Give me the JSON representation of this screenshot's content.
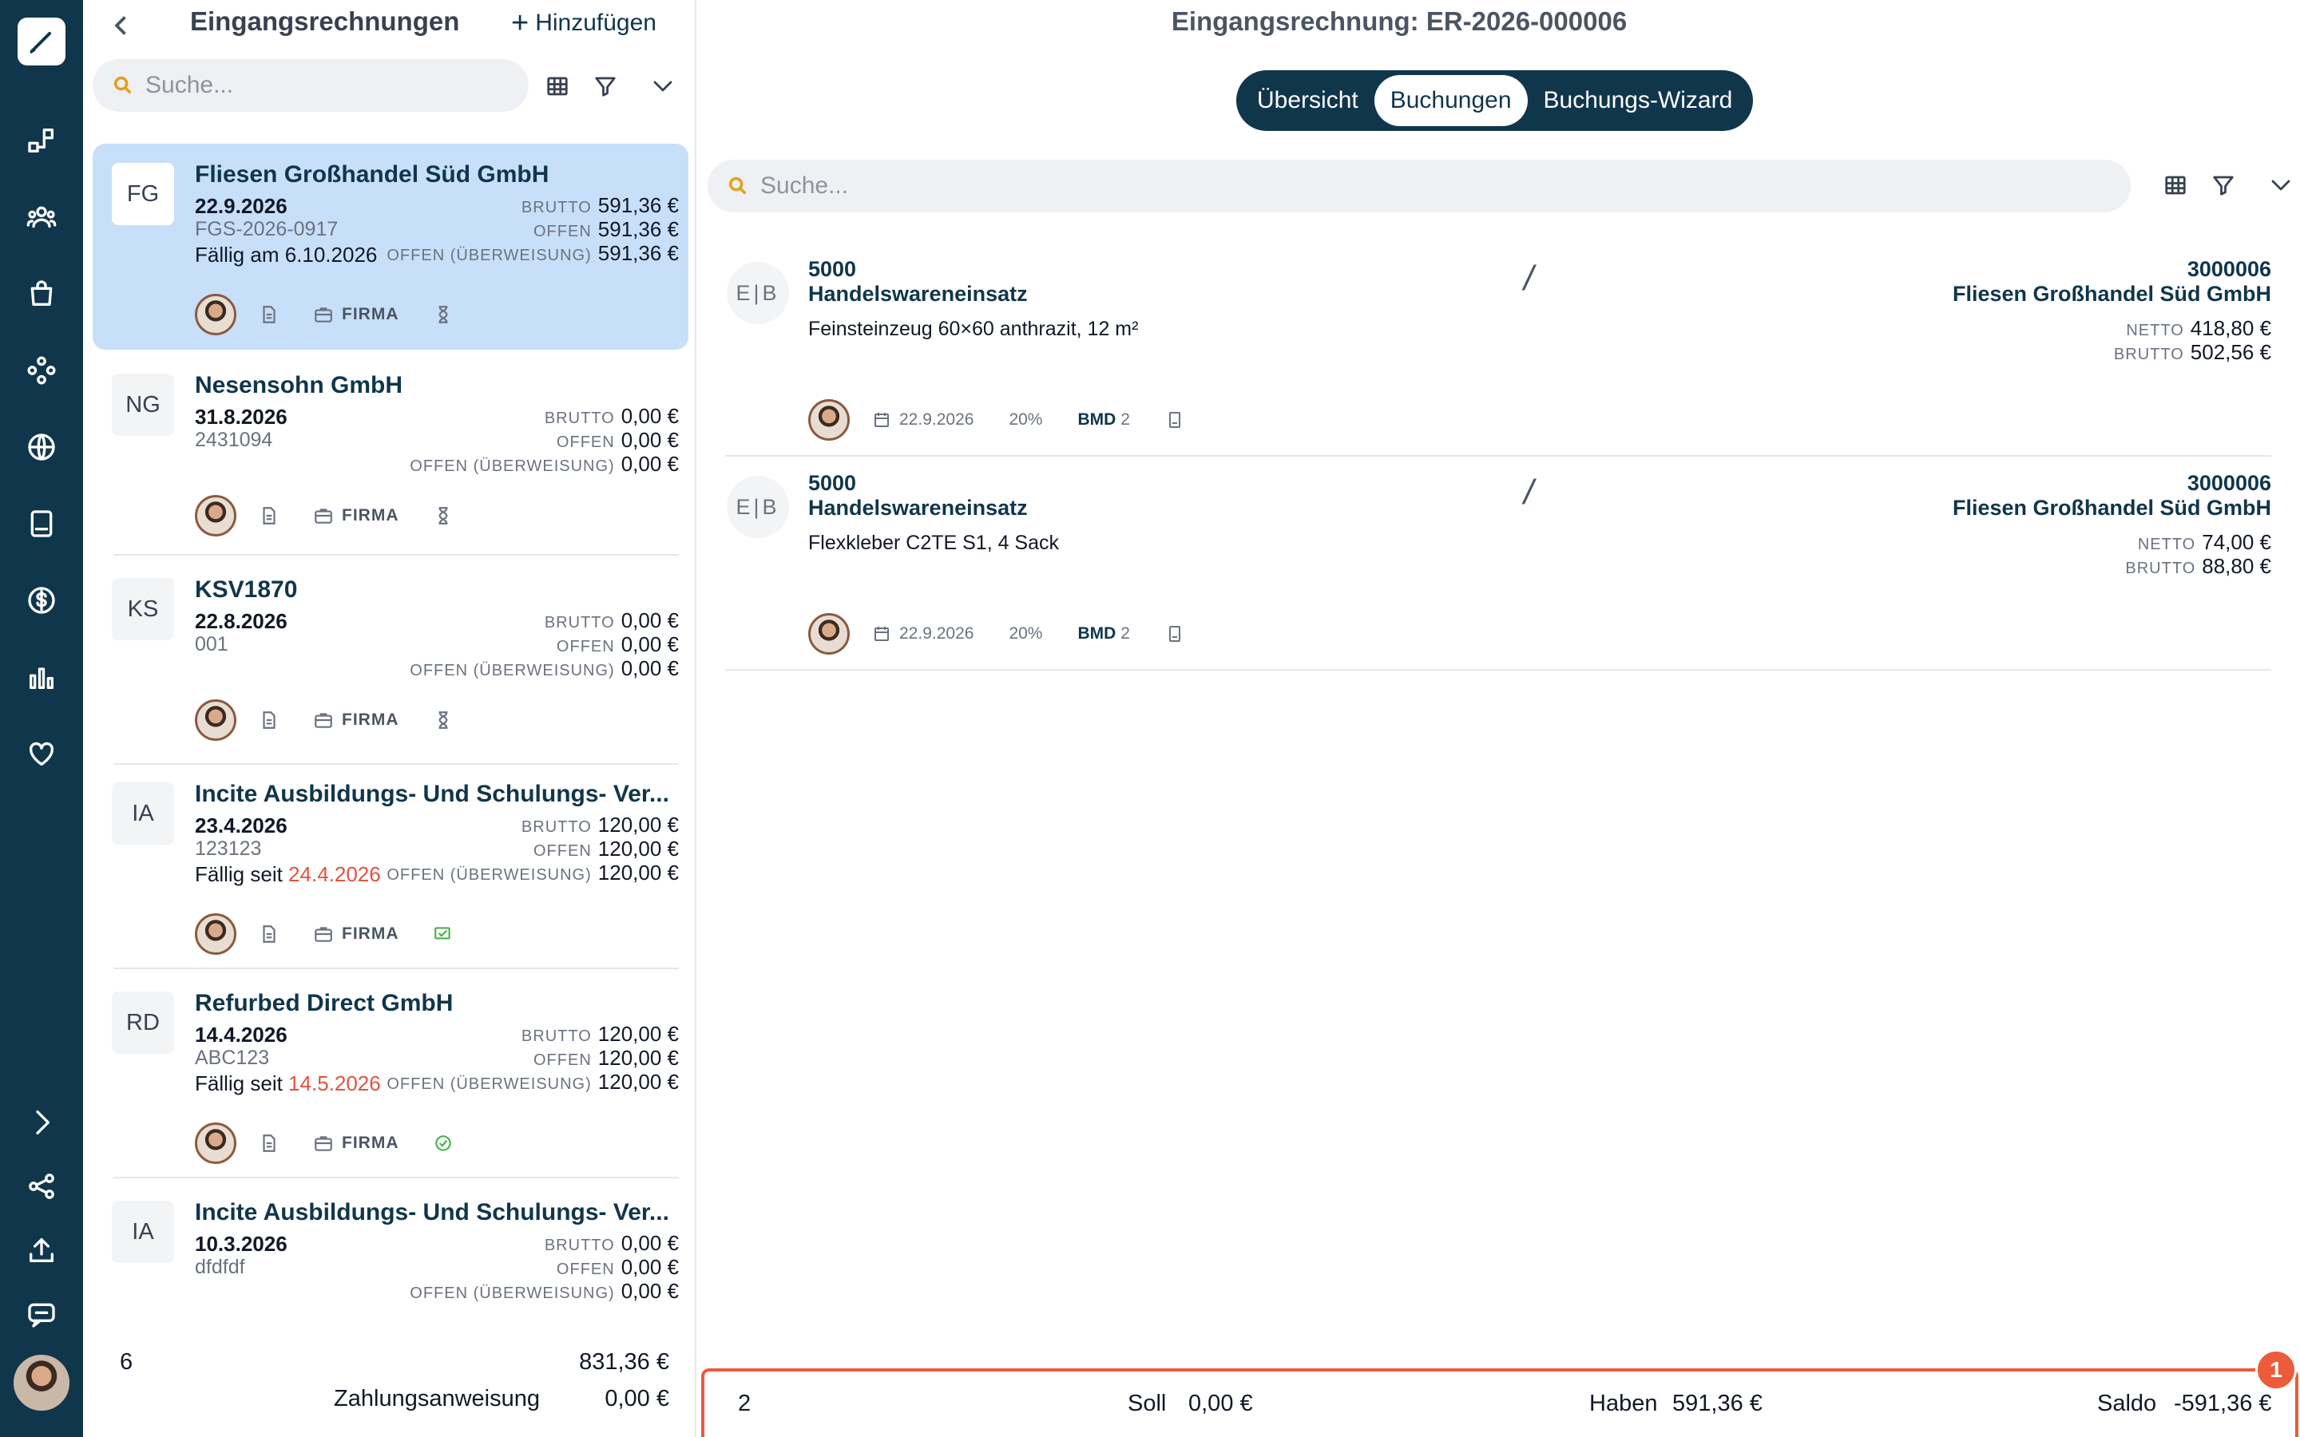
{
  "list": {
    "title": "Eingangsrechnungen",
    "add_label": "Hinzufügen",
    "search_placeholder": "Suche...",
    "items": [
      {
        "initials": "FG",
        "name": "Fliesen Großhandel Süd GmbH",
        "date": "22.9.2026",
        "ref": "FGS-2026-0917",
        "due_prefix": "Fällig am 6.10.2026",
        "due_date": "",
        "brutto": "591,36 €",
        "offen": "591,36 €",
        "offen_ueb": "591,36 €",
        "firma": "FIRMA",
        "status": "hourglass-icon"
      },
      {
        "initials": "NG",
        "name": "Nesensohn GmbH",
        "date": "31.8.2026",
        "ref": "2431094",
        "due_prefix": "",
        "due_date": "",
        "brutto": "0,00 €",
        "offen": "0,00 €",
        "offen_ueb": "0,00 €",
        "firma": "FIRMA",
        "status": "hourglass-icon"
      },
      {
        "initials": "KS",
        "name": "KSV1870",
        "date": "22.8.2026",
        "ref": "001",
        "due_prefix": "",
        "due_date": "",
        "brutto": "0,00 €",
        "offen": "0,00 €",
        "offen_ueb": "0,00 €",
        "firma": "FIRMA",
        "status": "hourglass-icon"
      },
      {
        "initials": "IA",
        "name": "Incite Ausbildungs- Und Schulungs- Ver...",
        "date": "23.4.2026",
        "ref": "123123",
        "due_prefix": "Fällig seit ",
        "due_date": "24.4.2026",
        "brutto": "120,00 €",
        "offen": "120,00 €",
        "offen_ueb": "120,00 €",
        "firma": "FIRMA",
        "status": "payment-scheduled-icon"
      },
      {
        "initials": "RD",
        "name": "Refurbed Direct GmbH",
        "date": "14.4.2026",
        "ref": "ABC123",
        "due_prefix": "Fällig seit ",
        "due_date": "14.5.2026",
        "brutto": "120,00 €",
        "offen": "120,00 €",
        "offen_ueb": "120,00 €",
        "firma": "FIRMA",
        "status": "check-circle-icon"
      },
      {
        "initials": "IA",
        "name": "Incite Ausbildungs- Und Schulungs- Ver...",
        "date": "10.3.2026",
        "ref": "dfdfdf",
        "due_prefix": "",
        "due_date": "",
        "brutto": "0,00 €",
        "offen": "0,00 €",
        "offen_ueb": "0,00 €",
        "firma": "FIRMA",
        "status": "hourglass-icon"
      }
    ],
    "labels": {
      "brutto": "BRUTTO",
      "offen": "OFFEN",
      "offen_ueb": "OFFEN (ÜBERWEISUNG)"
    },
    "footer": {
      "count": "6",
      "total": "831,36 €",
      "zahlungsanweisung_label": "Zahlungsanweisung",
      "zahlungsanweisung_value": "0,00 €"
    }
  },
  "detail": {
    "title": "Eingangsrechnung: ER-2026-000006",
    "tabs": [
      {
        "label": "Übersicht"
      },
      {
        "label": "Buchungen"
      },
      {
        "label": "Buchungs-Wizard"
      }
    ],
    "active_tab": "Buchungen",
    "search_placeholder": "Suche...",
    "bookings": [
      {
        "badge": "E|B",
        "account_no": "5000",
        "account_name": "Handelswareneinsatz",
        "slash": "/",
        "counter_no": "3000006",
        "counter_name": "Fliesen Großhandel Süd GmbH",
        "text": "Feinsteinzeug 60×60 anthrazit, 12 m²",
        "netto": "418,80 €",
        "brutto": "502,56 €",
        "date": "22.9.2026",
        "vat": "20%",
        "bmd": "BMD",
        "bmd_n": "2"
      },
      {
        "badge": "E|B",
        "account_no": "5000",
        "account_name": "Handelswareneinsatz",
        "slash": "/",
        "counter_no": "3000006",
        "counter_name": "Fliesen Großhandel Süd GmbH",
        "text": "Flexkleber C2TE S1, 4 Sack",
        "netto": "74,00 €",
        "brutto": "88,80 €",
        "date": "22.9.2026",
        "vat": "20%",
        "bmd": "BMD",
        "bmd_n": "2"
      }
    ],
    "amount_labels": {
      "netto": "NETTO",
      "brutto": "BRUTTO"
    },
    "footer": {
      "count": "2",
      "soll_label": "Soll",
      "soll_value": "0,00 €",
      "haben_label": "Haben",
      "haben_value": "591,36 €",
      "saldo_label": "Saldo",
      "saldo_value": "-591,36 €"
    },
    "notification_badge": "1"
  },
  "colors": {
    "rail": "#10364c",
    "accent": "#10364c",
    "selected": "#c8dff9",
    "late": "#e0533d",
    "alert": "#ec5b3a"
  }
}
